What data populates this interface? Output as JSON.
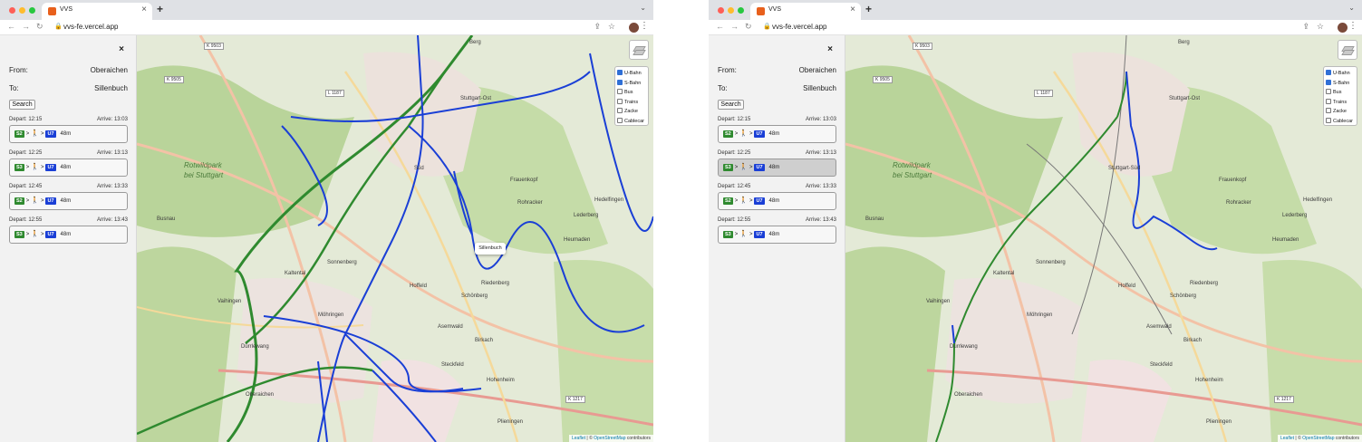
{
  "colors": {
    "s_bahn": "#2f8a2f",
    "u_bahn": "#1a3fd6",
    "tab_bar": "#dfe1e5",
    "sidebar": "#f2f2f2"
  },
  "windows": [
    {
      "browser": {
        "tab_title": "VVS",
        "tab_close": "×",
        "new_tab": "+",
        "tab_menu": "⌄",
        "url": "vvs-fe.vercel.app"
      },
      "sidebar": {
        "close": "×",
        "from_label": "From:",
        "from_value": "Oberaichen",
        "to_label": "To:",
        "to_value": "Sillenbuch",
        "search_label": "Search",
        "selected_trip": -1,
        "trips": [
          {
            "depart": "Depart: 12:15",
            "arrive": "Arrive: 13:03",
            "line1": "S2",
            "walk": "🚶",
            "line2": "U7",
            "duration": "48m"
          },
          {
            "depart": "Depart: 12:25",
            "arrive": "Arrive: 13:13",
            "line1": "S3",
            "walk": "🚶",
            "line2": "U7",
            "duration": "48m"
          },
          {
            "depart": "Depart: 12:45",
            "arrive": "Arrive: 13:33",
            "line1": "S2",
            "walk": "🚶",
            "line2": "U7",
            "duration": "48m"
          },
          {
            "depart": "Depart: 12:55",
            "arrive": "Arrive: 13:43",
            "line1": "S3",
            "walk": "🚶",
            "line2": "U7",
            "duration": "48m"
          }
        ]
      },
      "map": {
        "layers": [
          {
            "label": "U-Bahn",
            "checked": true
          },
          {
            "label": "S-Bahn",
            "checked": true
          },
          {
            "label": "Bus",
            "checked": false
          },
          {
            "label": "Trains",
            "checked": false
          },
          {
            "label": "Zacke",
            "checked": false
          },
          {
            "label": "Cablecar",
            "checked": false
          }
        ],
        "tooltip": "Sillenbuch",
        "attribution_leaflet": "Leaflet",
        "attribution_sep": " | © ",
        "attribution_osm": "OpenStreetMap",
        "attribution_tail": " contributors",
        "labels": {
          "berg": "Berg",
          "stuttgart_ost": "Stuttgart-Ost",
          "sud": "Süd",
          "rotwildpark": "Rotwildpark",
          "bei_stuttgart": "bei Stuttgart",
          "busnau": "Busnau",
          "frauenkopf": "Frauenkopf",
          "rohracker": "Rohracker",
          "lederberg": "Lederberg",
          "heumaden": "Heumaden",
          "sonnenberg": "Sonnenberg",
          "hoffeld": "Hoffeld",
          "riedenberg": "Riedenberg",
          "schonberg": "Schönberg",
          "asemwald": "Asemwald",
          "mohringen": "Möhringen",
          "vaihingen": "Vaihingen",
          "durrlewang": "Dürrlewang",
          "birkach": "Birkach",
          "steckfeld": "Steckfeld",
          "hohenheim": "Hohenheim",
          "oberaichen": "Oberaichen",
          "plieningen": "Plieningen",
          "kaltental": "Kaltental",
          "hedelfingen": "Hedelfingen",
          "k9503": "K 9503",
          "k9505": "K 9505",
          "l1187": "L 1187",
          "k1217": "K 1217"
        }
      }
    },
    {
      "browser": {
        "tab_title": "VVS",
        "tab_close": "×",
        "new_tab": "+",
        "tab_menu": "⌄",
        "url": "vvs-fe.vercel.app"
      },
      "sidebar": {
        "close": "×",
        "from_label": "From:",
        "from_value": "Oberaichen",
        "to_label": "To:",
        "to_value": "Sillenbuch",
        "search_label": "Search",
        "selected_trip": 1,
        "trips": [
          {
            "depart": "Depart: 12:15",
            "arrive": "Arrive: 13:03",
            "line1": "S2",
            "walk": "🚶",
            "line2": "U7",
            "duration": "48m"
          },
          {
            "depart": "Depart: 12:25",
            "arrive": "Arrive: 13:13",
            "line1": "S3",
            "walk": "🚶",
            "line2": "U7",
            "duration": "48m"
          },
          {
            "depart": "Depart: 12:45",
            "arrive": "Arrive: 13:33",
            "line1": "S2",
            "walk": "🚶",
            "line2": "U7",
            "duration": "48m"
          },
          {
            "depart": "Depart: 12:55",
            "arrive": "Arrive: 13:43",
            "line1": "S3",
            "walk": "🚶",
            "line2": "U7",
            "duration": "48m"
          }
        ]
      },
      "map": {
        "layers": [
          {
            "label": "U-Bahn",
            "checked": true
          },
          {
            "label": "S-Bahn",
            "checked": true
          },
          {
            "label": "Bus",
            "checked": false
          },
          {
            "label": "Trains",
            "checked": false
          },
          {
            "label": "Zacke",
            "checked": false
          },
          {
            "label": "Cablecar",
            "checked": false
          }
        ],
        "tooltip": "",
        "attribution_leaflet": "Leaflet",
        "attribution_sep": " | © ",
        "attribution_osm": "OpenStreetMap",
        "attribution_tail": " contributors",
        "labels": {
          "berg": "Berg",
          "stuttgart_ost": "Stuttgart-Ost",
          "sud": "Stuttgart-Süd",
          "rotwildpark": "Rotwildpark",
          "bei_stuttgart": "bei Stuttgart",
          "busnau": "Busnau",
          "frauenkopf": "Frauenkopf",
          "rohracker": "Rohracker",
          "lederberg": "Lederberg",
          "heumaden": "Heumaden",
          "sonnenberg": "Sonnenberg",
          "hoffeld": "Hoffeld",
          "riedenberg": "Riedenberg",
          "schonberg": "Schönberg",
          "asemwald": "Asemwald",
          "mohringen": "Möhringen",
          "vaihingen": "Vaihingen",
          "durrlewang": "Dürrlewang",
          "birkach": "Birkach",
          "steckfeld": "Steckfeld",
          "hohenheim": "Hohenheim",
          "oberaichen": "Oberaichen",
          "plieningen": "Plieningen",
          "kaltental": "Kaltental",
          "hedelfingen": "Hedelfingen",
          "k9503": "K 9503",
          "k9505": "K 9505",
          "l1187": "L 1187",
          "k1217": "K 1217"
        }
      }
    }
  ]
}
